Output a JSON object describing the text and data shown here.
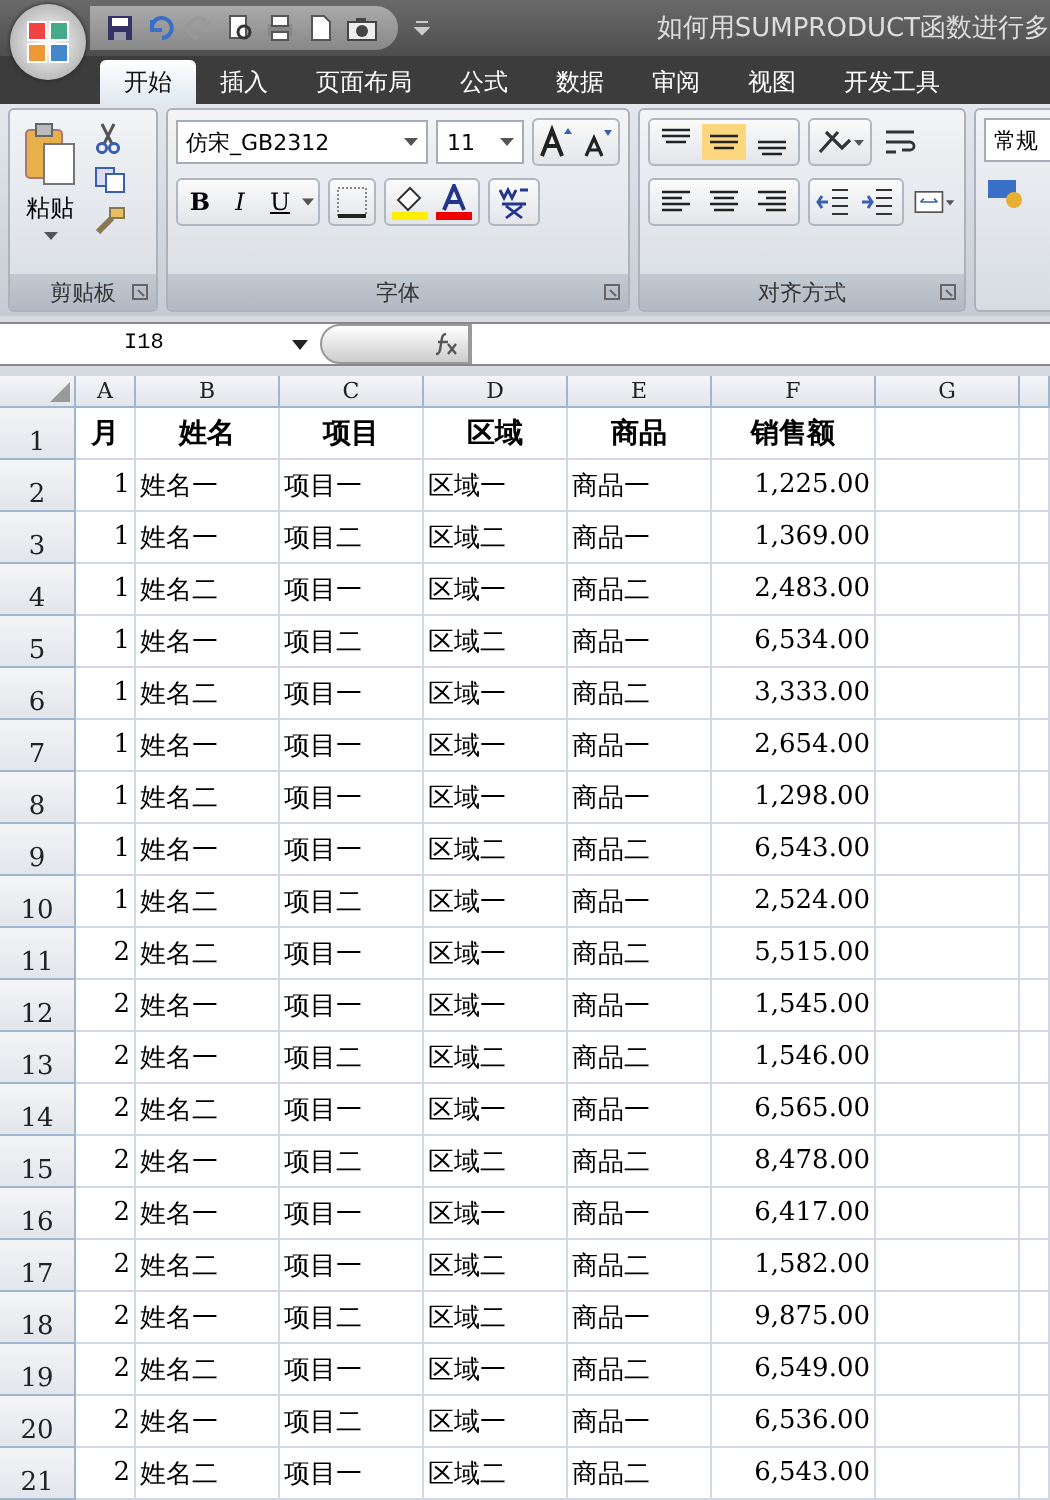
{
  "title_bar": {
    "title": "如何用SUMPRODUCT函数进行多"
  },
  "tabs": [
    {
      "label": "开始",
      "selected": true
    },
    {
      "label": "插入",
      "selected": false
    },
    {
      "label": "页面布局",
      "selected": false
    },
    {
      "label": "公式",
      "selected": false
    },
    {
      "label": "数据",
      "selected": false
    },
    {
      "label": "审阅",
      "selected": false
    },
    {
      "label": "视图",
      "selected": false
    },
    {
      "label": "开发工具",
      "selected": false
    }
  ],
  "ribbon": {
    "clipboard": {
      "paste_label": "粘贴",
      "group_label": "剪贴板"
    },
    "font": {
      "font_name": "仿宋_GB2312",
      "font_size": "11",
      "format_buttons": [
        "B",
        "I",
        "U"
      ],
      "group_label": "字体"
    },
    "alignment": {
      "vertical_buttons": [
        {
          "selected": false
        },
        {
          "selected": true
        },
        {
          "selected": false
        }
      ],
      "group_label": "对齐方式"
    },
    "number": {
      "format": "常规"
    }
  },
  "formula_bar": {
    "name_box": "I18"
  },
  "columns": [
    "A",
    "B",
    "C",
    "D",
    "E",
    "F",
    "G"
  ],
  "rows": [
    {
      "number": "1",
      "kind": "header",
      "cells": [
        "月",
        "姓名",
        "项目",
        "区域",
        "商品",
        "销售额",
        ""
      ]
    },
    {
      "number": "2",
      "kind": "data",
      "cells": [
        "1",
        "姓名一",
        "项目一",
        "区域一",
        "商品一",
        "1,225.00",
        ""
      ]
    },
    {
      "number": "3",
      "kind": "data",
      "cells": [
        "1",
        "姓名一",
        "项目二",
        "区域二",
        "商品一",
        "1,369.00",
        ""
      ]
    },
    {
      "number": "4",
      "kind": "data",
      "cells": [
        "1",
        "姓名二",
        "项目一",
        "区域一",
        "商品二",
        "2,483.00",
        ""
      ]
    },
    {
      "number": "5",
      "kind": "data",
      "cells": [
        "1",
        "姓名一",
        "项目二",
        "区域二",
        "商品一",
        "6,534.00",
        ""
      ]
    },
    {
      "number": "6",
      "kind": "data",
      "cells": [
        "1",
        "姓名二",
        "项目一",
        "区域一",
        "商品二",
        "3,333.00",
        ""
      ]
    },
    {
      "number": "7",
      "kind": "data",
      "cells": [
        "1",
        "姓名一",
        "项目一",
        "区域一",
        "商品一",
        "2,654.00",
        ""
      ]
    },
    {
      "number": "8",
      "kind": "data",
      "cells": [
        "1",
        "姓名二",
        "项目一",
        "区域一",
        "商品一",
        "1,298.00",
        ""
      ]
    },
    {
      "number": "9",
      "kind": "data",
      "cells": [
        "1",
        "姓名一",
        "项目一",
        "区域二",
        "商品二",
        "6,543.00",
        ""
      ]
    },
    {
      "number": "10",
      "kind": "data",
      "cells": [
        "1",
        "姓名二",
        "项目二",
        "区域一",
        "商品一",
        "2,524.00",
        ""
      ]
    },
    {
      "number": "11",
      "kind": "data",
      "cells": [
        "2",
        "姓名二",
        "项目一",
        "区域一",
        "商品二",
        "5,515.00",
        ""
      ]
    },
    {
      "number": "12",
      "kind": "data",
      "cells": [
        "2",
        "姓名一",
        "项目一",
        "区域一",
        "商品一",
        "1,545.00",
        ""
      ]
    },
    {
      "number": "13",
      "kind": "data",
      "cells": [
        "2",
        "姓名一",
        "项目二",
        "区域二",
        "商品二",
        "1,546.00",
        ""
      ]
    },
    {
      "number": "14",
      "kind": "data",
      "cells": [
        "2",
        "姓名二",
        "项目一",
        "区域一",
        "商品一",
        "6,565.00",
        ""
      ]
    },
    {
      "number": "15",
      "kind": "data",
      "cells": [
        "2",
        "姓名一",
        "项目二",
        "区域二",
        "商品二",
        "8,478.00",
        ""
      ]
    },
    {
      "number": "16",
      "kind": "data",
      "cells": [
        "2",
        "姓名一",
        "项目一",
        "区域一",
        "商品一",
        "6,417.00",
        ""
      ]
    },
    {
      "number": "17",
      "kind": "data",
      "cells": [
        "2",
        "姓名二",
        "项目一",
        "区域二",
        "商品二",
        "1,582.00",
        ""
      ]
    },
    {
      "number": "18",
      "kind": "data",
      "cells": [
        "2",
        "姓名一",
        "项目二",
        "区域二",
        "商品一",
        "9,875.00",
        ""
      ]
    },
    {
      "number": "19",
      "kind": "data",
      "cells": [
        "2",
        "姓名二",
        "项目一",
        "区域一",
        "商品二",
        "6,549.00",
        ""
      ]
    },
    {
      "number": "20",
      "kind": "data",
      "cells": [
        "2",
        "姓名一",
        "项目二",
        "区域一",
        "商品一",
        "6,536.00",
        ""
      ]
    },
    {
      "number": "21",
      "kind": "data",
      "cells": [
        "2",
        "姓名二",
        "项目一",
        "区域二",
        "商品二",
        "6,543.00",
        ""
      ]
    }
  ]
}
